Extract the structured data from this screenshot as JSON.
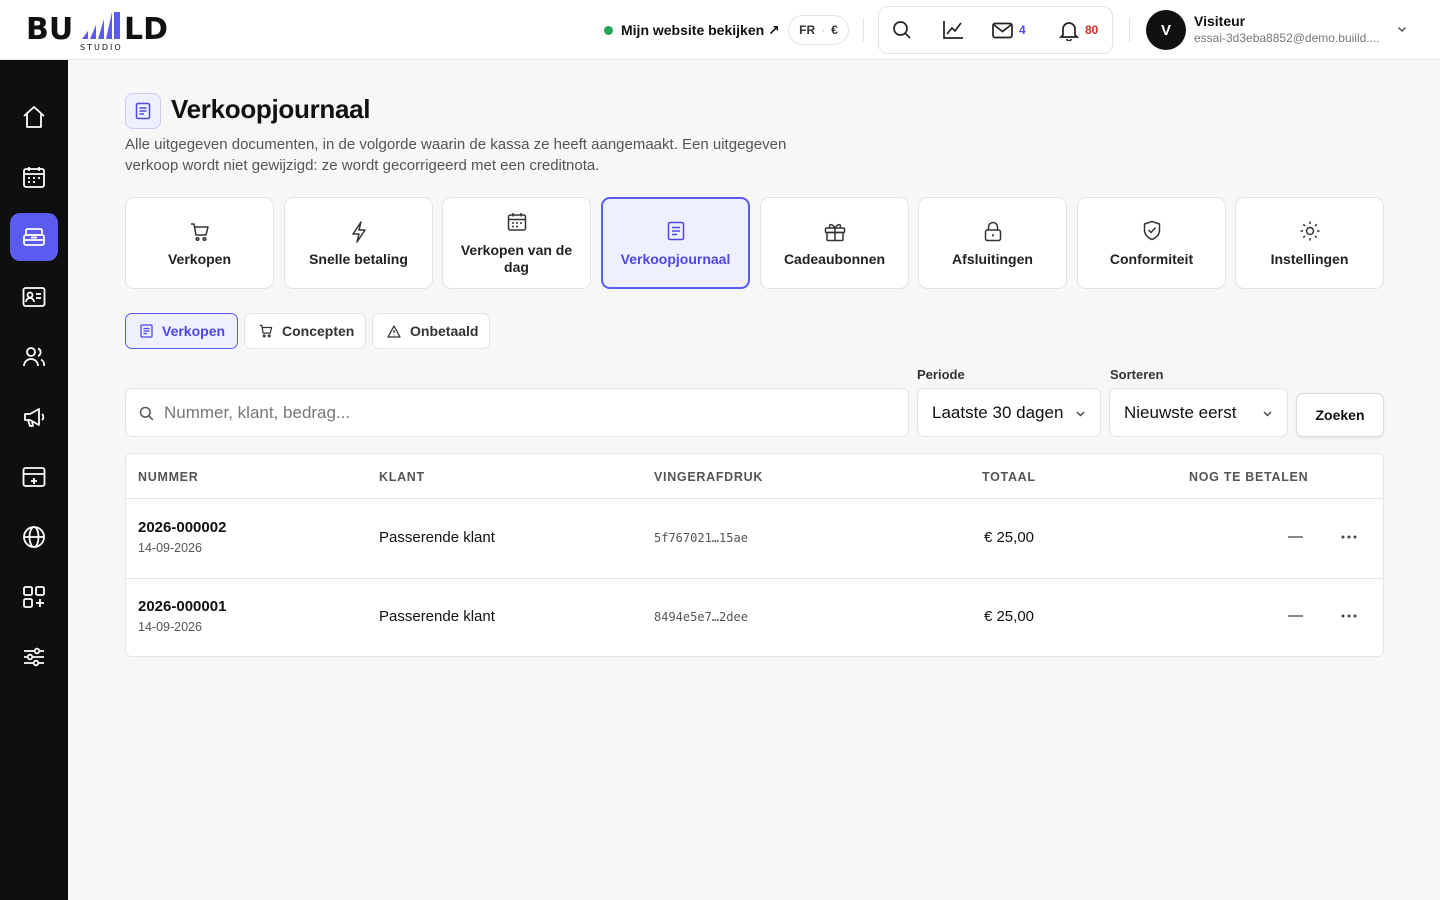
{
  "brand": {
    "logo_text": "BU  LD",
    "logo_sub": "STUDIO"
  },
  "topbar": {
    "website_link": "Mijn website bekijken ↗",
    "lang": "FR",
    "currency": "€",
    "messages_count": "4",
    "notifications_count": "80",
    "user_initial": "V",
    "user_name": "Visiteur",
    "user_email": "essai-3d3eba8852@demo.buiild...."
  },
  "sidebar": {
    "items": [
      {
        "icon": "home-icon"
      },
      {
        "icon": "calendar-icon"
      },
      {
        "icon": "cash-register-icon",
        "active": true
      },
      {
        "icon": "id-card-icon"
      },
      {
        "icon": "users-icon"
      },
      {
        "icon": "megaphone-icon"
      },
      {
        "icon": "payment-terminal-icon"
      },
      {
        "icon": "globe-icon"
      },
      {
        "icon": "apps-add-icon"
      },
      {
        "icon": "sliders-icon"
      }
    ]
  },
  "page": {
    "title": "Verkoopjournaal",
    "description": "Alle uitgegeven documenten, in de volgorde waarin de kassa ze heeft aangemaakt. Een uitgegeven verkoop wordt niet gewijzigd: ze wordt gecorrigeerd met een creditnota."
  },
  "categories": [
    {
      "label": "Verkopen",
      "icon": "cart-icon"
    },
    {
      "label": "Snelle betaling",
      "icon": "lightning-icon"
    },
    {
      "label": "Verkopen van de dag",
      "icon": "calendar-icon"
    },
    {
      "label": "Verkoopjournaal",
      "icon": "document-icon",
      "active": true
    },
    {
      "label": "Cadeaubonnen",
      "icon": "gift-icon"
    },
    {
      "label": "Afsluitingen",
      "icon": "lock-icon"
    },
    {
      "label": "Conformiteit",
      "icon": "shield-check-icon"
    },
    {
      "label": "Instellingen",
      "icon": "sun-gear-icon"
    }
  ],
  "subtabs": [
    {
      "label": "Verkopen",
      "icon": "document-icon",
      "active": true
    },
    {
      "label": "Concepten",
      "icon": "cart-icon"
    },
    {
      "label": "Onbetaald",
      "icon": "warning-icon"
    }
  ],
  "filters": {
    "search_placeholder": "Nummer, klant, bedrag...",
    "period_label": "Periode",
    "period_value": "Laatste 30 dagen",
    "sort_label": "Sorteren",
    "sort_value": "Nieuwste eerst",
    "search_button": "Zoeken"
  },
  "table": {
    "headers": {
      "number": "NUMMER",
      "client": "KLANT",
      "fingerprint": "VINGERAFDRUK",
      "total": "TOTAAL",
      "due": "NOG TE BETALEN"
    },
    "rows": [
      {
        "number": "2026-000002",
        "date": "14-09-2026",
        "client": "Passerende klant",
        "fingerprint": "5f767021…15ae",
        "total": "€ 25,00",
        "due": "—"
      },
      {
        "number": "2026-000001",
        "date": "14-09-2026",
        "client": "Passerende klant",
        "fingerprint": "8494e5e7…2dee",
        "total": "€ 25,00",
        "due": "—"
      }
    ]
  },
  "colors": {
    "accent": "#5b5bf0",
    "accent_text": "#4f46e5",
    "sidebar_bg": "#0f0f10",
    "online": "#22a559",
    "notification": "#dc2626"
  }
}
